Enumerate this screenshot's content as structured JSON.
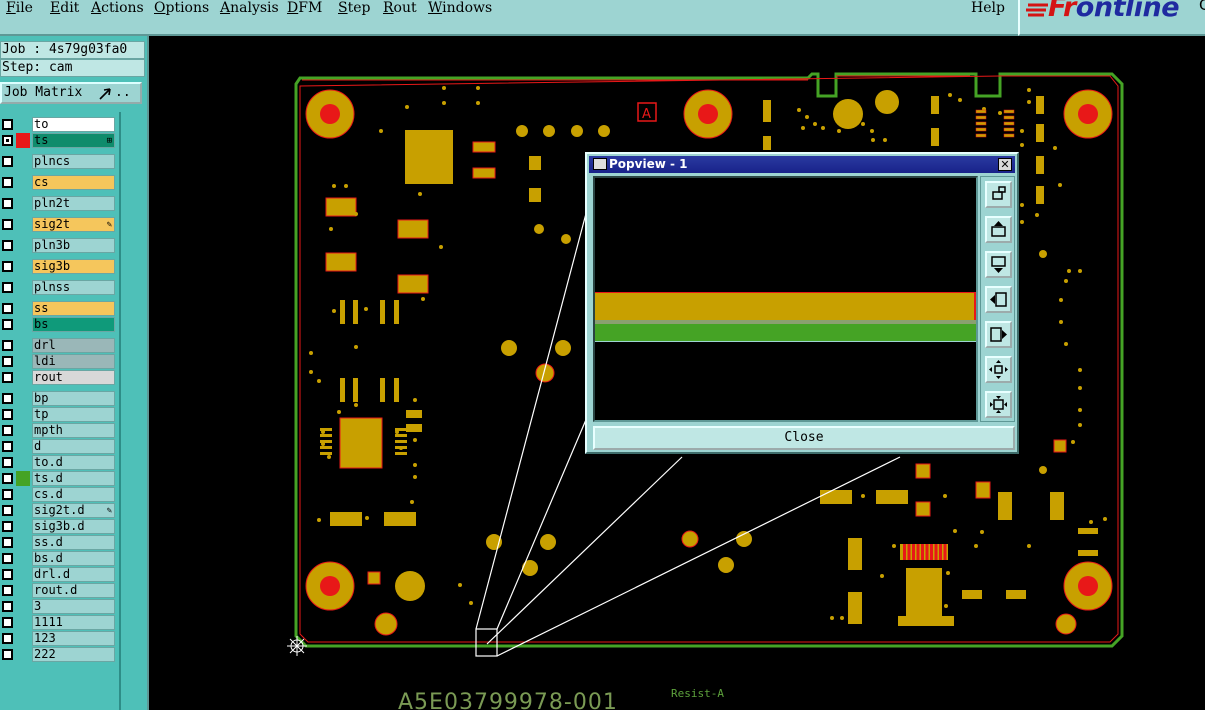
{
  "menubar": {
    "items": [
      {
        "label": "File",
        "underline": "F",
        "rest": "ile"
      },
      {
        "label": "Edit",
        "underline": "E",
        "rest": "dit"
      },
      {
        "label": "Actions",
        "underline": "A",
        "rest": "ctions"
      },
      {
        "label": "Options",
        "underline": "O",
        "rest": "ptions"
      },
      {
        "label": "Analysis",
        "underline": "A",
        "rest": "nalysis"
      },
      {
        "label": "DFM",
        "underline": "D",
        "rest": "FM"
      },
      {
        "label": "Step",
        "underline": "S",
        "rest": "tep"
      },
      {
        "label": "Rout",
        "underline": "R",
        "rest": "out"
      },
      {
        "label": "Windows",
        "underline": "W",
        "rest": "indows"
      }
    ],
    "help": "Help"
  },
  "logo": {
    "text": "Frontline",
    "superscript": "G"
  },
  "job_info": {
    "job": "Job : 4s79g03fa0",
    "step": "Step: cam"
  },
  "job_matrix_label": "Job Matrix",
  "layers": [
    {
      "name": "to",
      "color": "#ffffff",
      "indicator": "",
      "mark": ""
    },
    {
      "name": "ts",
      "color": "#0f8c6c",
      "indicator": "#e81818",
      "mark": "⊞",
      "active": true
    },
    {
      "name": "plncs",
      "color": "#9dd4d2",
      "indicator": "",
      "mark": ""
    },
    {
      "name": "cs",
      "color": "#f5c65c",
      "indicator": "",
      "mark": ""
    },
    {
      "name": "pln2t",
      "color": "#9dd4d2",
      "indicator": "",
      "mark": ""
    },
    {
      "name": "sig2t",
      "color": "#f5c65c",
      "indicator": "",
      "mark": "✎"
    },
    {
      "name": "pln3b",
      "color": "#9dd4d2",
      "indicator": "",
      "mark": ""
    },
    {
      "name": "sig3b",
      "color": "#f5c65c",
      "indicator": "",
      "mark": ""
    },
    {
      "name": "plnss",
      "color": "#9dd4d2",
      "indicator": "",
      "mark": ""
    },
    {
      "name": "ss",
      "color": "#f5c65c",
      "indicator": "",
      "mark": ""
    },
    {
      "name": "bs",
      "color": "#0f9a7a",
      "indicator": "",
      "mark": ""
    },
    {
      "name": "drl",
      "color": "#9ab7b8",
      "indicator": "",
      "mark": ""
    },
    {
      "name": "ldi",
      "color": "#9ab7b8",
      "indicator": "",
      "mark": ""
    },
    {
      "name": "rout",
      "color": "#d8d8d8",
      "indicator": "",
      "mark": ""
    },
    {
      "name": "bp",
      "color": "#9dd4d2",
      "indicator": "",
      "mark": ""
    },
    {
      "name": "tp",
      "color": "#9dd4d2",
      "indicator": "",
      "mark": ""
    },
    {
      "name": "mpth",
      "color": "#9dd4d2",
      "indicator": "",
      "mark": ""
    },
    {
      "name": "d",
      "color": "#9dd4d2",
      "indicator": "",
      "mark": ""
    },
    {
      "name": "to.d",
      "color": "#9dd4d2",
      "indicator": "",
      "mark": ""
    },
    {
      "name": "ts.d",
      "color": "#9dd4d2",
      "indicator": "#45a325",
      "mark": ""
    },
    {
      "name": "cs.d",
      "color": "#9dd4d2",
      "indicator": "",
      "mark": ""
    },
    {
      "name": "sig2t.d",
      "color": "#9dd4d2",
      "indicator": "",
      "mark": "✎"
    },
    {
      "name": "sig3b.d",
      "color": "#9dd4d2",
      "indicator": "",
      "mark": ""
    },
    {
      "name": "ss.d",
      "color": "#9dd4d2",
      "indicator": "",
      "mark": ""
    },
    {
      "name": "bs.d",
      "color": "#9dd4d2",
      "indicator": "",
      "mark": ""
    },
    {
      "name": "drl.d",
      "color": "#9dd4d2",
      "indicator": "",
      "mark": ""
    },
    {
      "name": "rout.d",
      "color": "#9dd4d2",
      "indicator": "",
      "mark": ""
    },
    {
      "name": "3",
      "color": "#9dd4d2",
      "indicator": "",
      "mark": ""
    },
    {
      "name": "1111",
      "color": "#9dd4d2",
      "indicator": "",
      "mark": ""
    },
    {
      "name": "123",
      "color": "#9dd4d2",
      "indicator": "",
      "mark": ""
    },
    {
      "name": "222",
      "color": "#9dd4d2",
      "indicator": "",
      "mark": ""
    }
  ],
  "popup": {
    "title": "Popview - 1",
    "close_label": "Close",
    "tools": [
      "zoom-home-icon",
      "pan-up-icon",
      "pan-down-icon",
      "pan-left-icon",
      "pan-right-icon",
      "zoom-in-icon",
      "zoom-out-icon"
    ]
  },
  "canvas": {
    "pin_label": "A",
    "bottom_text": "A5E03799978-001",
    "resist_text": "Resist-A"
  },
  "colors": {
    "board_outline": "#45a325",
    "board_edge": "#e81818",
    "copper": "#c8a000",
    "panel_bg": "#9dd4d2"
  }
}
